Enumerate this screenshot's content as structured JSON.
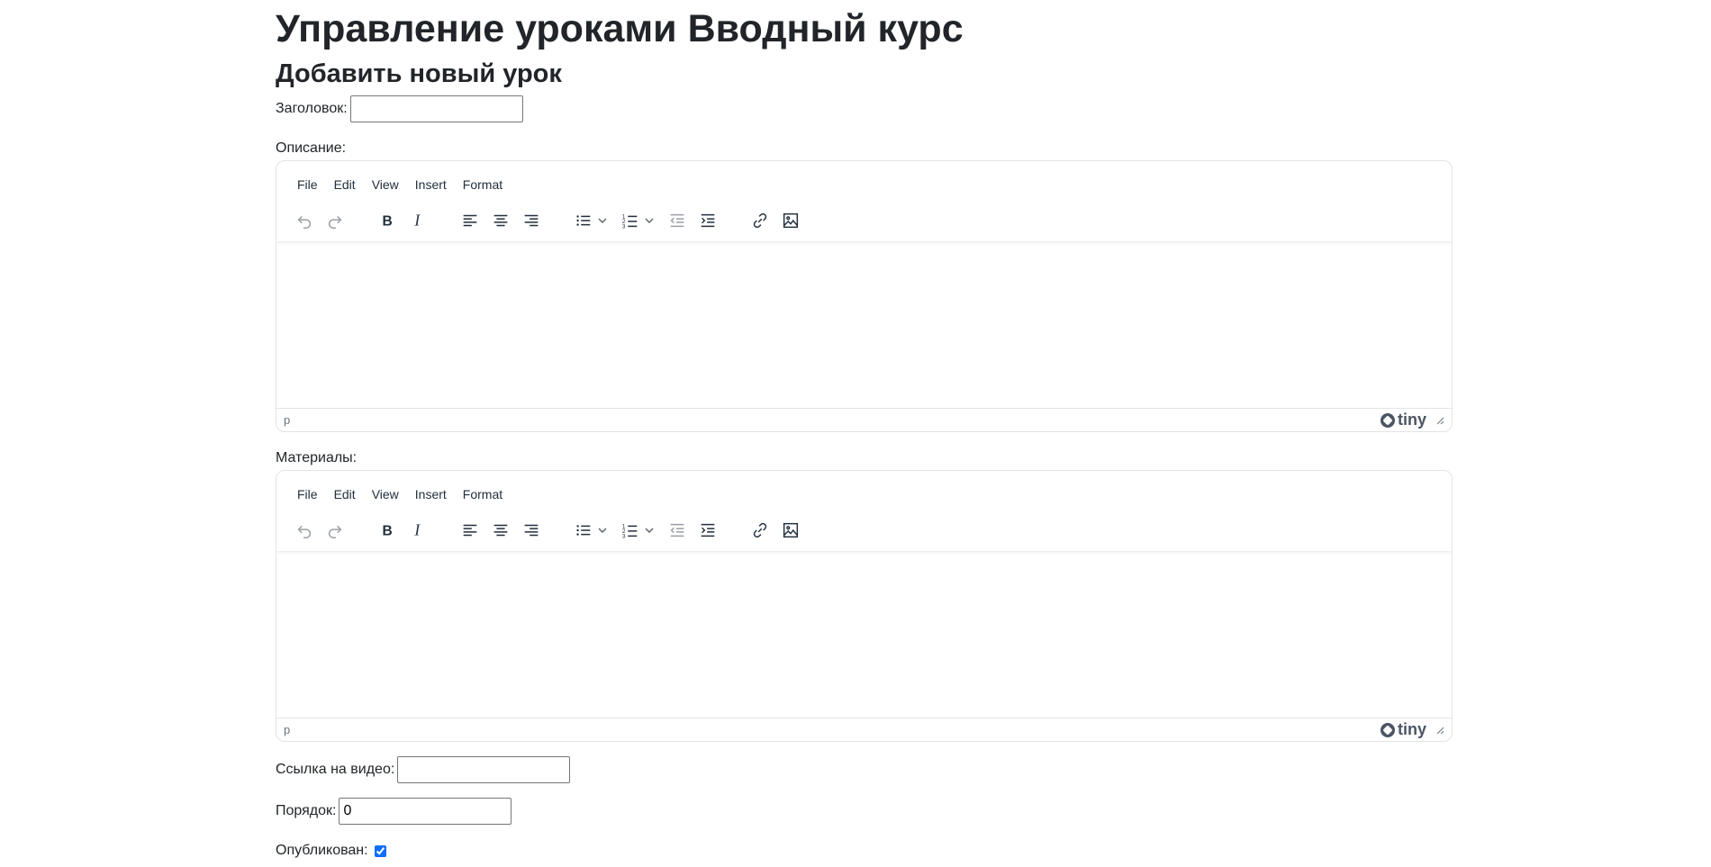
{
  "page": {
    "title": "Управление уроками Вводный курс",
    "subtitle": "Добавить новый урок"
  },
  "form": {
    "title_label": "Заголовок:",
    "title_value": "",
    "description_label": "Описание:",
    "materials_label": "Материалы:",
    "video_label": "Ссылка на видео:",
    "video_value": "",
    "order_label": "Порядок:",
    "order_value": "0",
    "published_label": "Опубликован:",
    "published_checked": true
  },
  "editor": {
    "menu": [
      "File",
      "Edit",
      "View",
      "Insert",
      "Format"
    ],
    "status_path": "p",
    "brand": "tiny",
    "toolbar_icons": [
      "undo-icon",
      "redo-icon",
      "bold-icon",
      "italic-icon",
      "align-left-icon",
      "align-center-icon",
      "align-right-icon",
      "bullet-list-icon",
      "numbered-list-icon",
      "outdent-icon",
      "indent-icon",
      "link-icon",
      "image-icon"
    ]
  },
  "colors": {
    "text": "#212529",
    "editor_icon": "#222f3e",
    "checkbox_accent": "#0d6efd"
  }
}
